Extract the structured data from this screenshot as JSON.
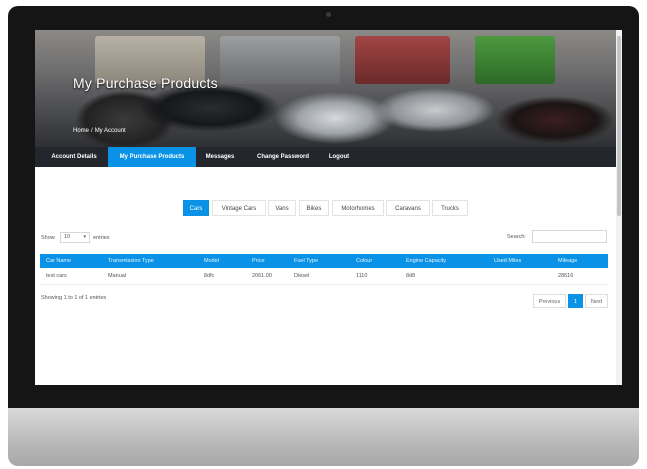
{
  "hero": {
    "title": "My Purchase Products"
  },
  "breadcrumb": {
    "home": "Home",
    "sep": "/",
    "current": "My Account"
  },
  "nav": {
    "items": [
      {
        "label": "Account Details"
      },
      {
        "label": "My Purchase Products"
      },
      {
        "label": "Messages"
      },
      {
        "label": "Change Password"
      },
      {
        "label": "Logout"
      }
    ],
    "active_index": 1
  },
  "tabs": {
    "items": [
      {
        "label": "Cars"
      },
      {
        "label": "Vintage Cars"
      },
      {
        "label": "Vans"
      },
      {
        "label": "Bikes"
      },
      {
        "label": "Motorhomes"
      },
      {
        "label": "Caravans"
      },
      {
        "label": "Trucks"
      }
    ],
    "active_index": 0
  },
  "controls": {
    "show_label": "Show",
    "entries_value": "10",
    "entries_label": "entries",
    "search_label": "Search:"
  },
  "table": {
    "columns": [
      "Car Name",
      "Transmission Type",
      "Model",
      "Price",
      "Fuel Type",
      "Colour",
      "Engine Capacity",
      "Used Miles",
      "Mileage"
    ],
    "rows": [
      [
        "test cars",
        "Manual",
        "8dfc",
        "2061.00",
        "Diesel",
        "1110",
        "8d8",
        "",
        "28616"
      ]
    ]
  },
  "footer": {
    "info": "Showing 1 to 1 of 1 entries",
    "previous": "Previous",
    "page": "1",
    "next": "Next"
  },
  "colors": {
    "accent": "#0a93e6",
    "nav_bg": "#23272d",
    "bezel": "#151515"
  }
}
